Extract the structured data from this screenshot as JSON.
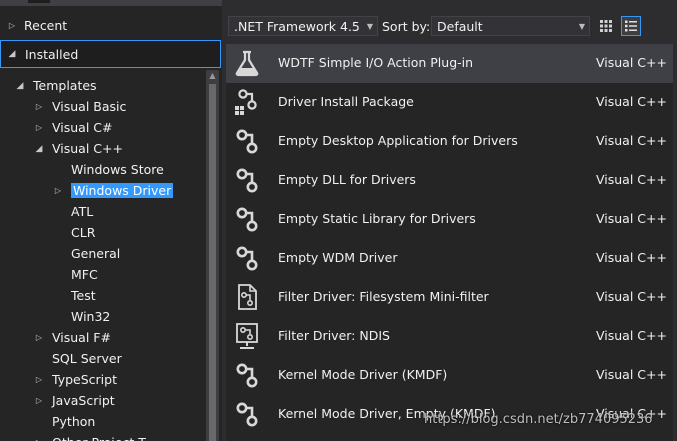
{
  "left_pane": {
    "recent_label": "Recent",
    "installed_label": "Installed",
    "tree": [
      {
        "label": "Templates",
        "level": 1,
        "arrow": "open"
      },
      {
        "label": "Visual Basic",
        "level": 2,
        "arrow": "closed"
      },
      {
        "label": "Visual C#",
        "level": 2,
        "arrow": "closed"
      },
      {
        "label": "Visual C++",
        "level": 2,
        "arrow": "open"
      },
      {
        "label": "Windows Store",
        "level": 3,
        "arrow": "none"
      },
      {
        "label": "Windows Driver",
        "level": 3,
        "arrow": "closed",
        "selected": true
      },
      {
        "label": "ATL",
        "level": 3,
        "arrow": "none"
      },
      {
        "label": "CLR",
        "level": 3,
        "arrow": "none"
      },
      {
        "label": "General",
        "level": 3,
        "arrow": "none"
      },
      {
        "label": "MFC",
        "level": 3,
        "arrow": "none"
      },
      {
        "label": "Test",
        "level": 3,
        "arrow": "none"
      },
      {
        "label": "Win32",
        "level": 3,
        "arrow": "none"
      },
      {
        "label": "Visual F#",
        "level": 2,
        "arrow": "closed"
      },
      {
        "label": "SQL Server",
        "level": 2,
        "arrow": "none"
      },
      {
        "label": "TypeScript",
        "level": 2,
        "arrow": "closed"
      },
      {
        "label": "JavaScript",
        "level": 2,
        "arrow": "closed"
      },
      {
        "label": "Python",
        "level": 2,
        "arrow": "none"
      },
      {
        "label": "Other Project T",
        "level": 2,
        "arrow": "closed"
      }
    ]
  },
  "toolbar": {
    "framework_value": ".NET Framework 4.5",
    "sort_label": "Sort by:",
    "sort_value": "Default",
    "small_icons_view_icon": "grid-view-icon",
    "list_view_icon": "list-view-icon"
  },
  "templates": [
    {
      "name": "WDTF Simple I/O Action Plug-in",
      "lang": "Visual C++",
      "icon": "flask-icon",
      "selected": true
    },
    {
      "name": "Driver Install Package",
      "lang": "Visual C++",
      "icon": "driver-package-icon"
    },
    {
      "name": "Empty Desktop Application for Drivers",
      "lang": "Visual C++",
      "icon": "driver-icon"
    },
    {
      "name": "Empty DLL for Drivers",
      "lang": "Visual C++",
      "icon": "driver-icon"
    },
    {
      "name": "Empty Static Library for Drivers",
      "lang": "Visual C++",
      "icon": "driver-icon"
    },
    {
      "name": "Empty WDM Driver",
      "lang": "Visual C++",
      "icon": "driver-icon"
    },
    {
      "name": "Filter Driver: Filesystem Mini-filter",
      "lang": "Visual C++",
      "icon": "filter-document-icon"
    },
    {
      "name": "Filter Driver: NDIS",
      "lang": "Visual C++",
      "icon": "network-filter-icon"
    },
    {
      "name": "Kernel Mode Driver (KMDF)",
      "lang": "Visual C++",
      "icon": "driver-icon"
    },
    {
      "name": "Kernel Mode Driver, Empty (KMDF)",
      "lang": "Visual C++",
      "icon": "driver-icon"
    }
  ],
  "watermark": "https://blog.csdn.net/zb774095236",
  "colors": {
    "selection": "#3399ff",
    "background": "#2d2d30",
    "panel": "#252526",
    "selected_row": "#3f3f46"
  }
}
